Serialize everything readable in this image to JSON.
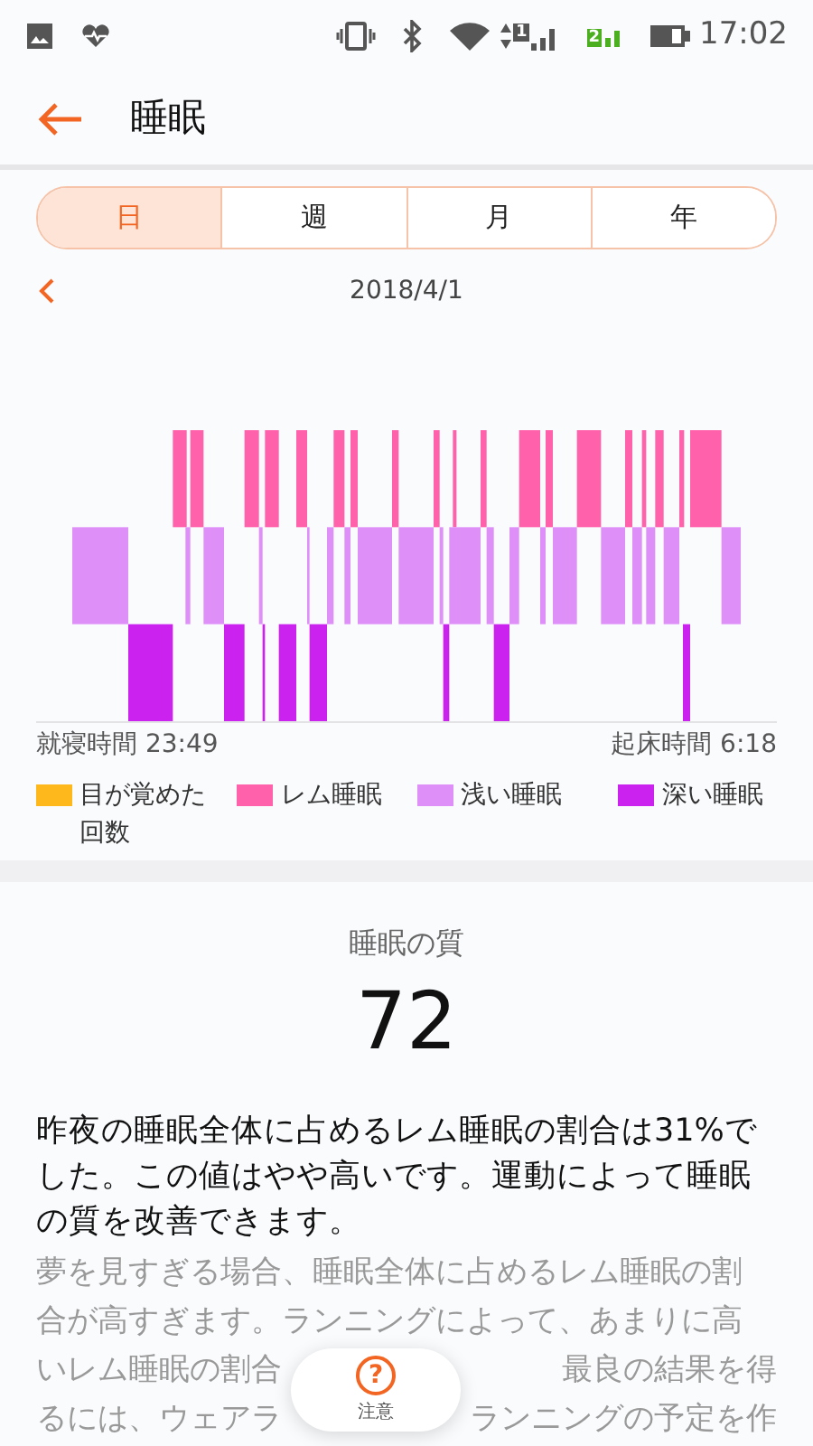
{
  "status_bar": {
    "sim_1": "1",
    "sim_2": "2",
    "time": "17:02"
  },
  "header": {
    "title": "睡眠"
  },
  "tabs": [
    {
      "label": "日",
      "selected": true
    },
    {
      "label": "週",
      "selected": false
    },
    {
      "label": "月",
      "selected": false
    },
    {
      "label": "年",
      "selected": false
    }
  ],
  "date_nav": {
    "date": "2018/4/1"
  },
  "chart": {
    "bedtime": "就寝時間 23:49",
    "wake_time": "起床時間 6:18"
  },
  "legend": [
    {
      "label": "目が覚めた回数",
      "color": "#ffb81c"
    },
    {
      "label": "レム睡眠",
      "color": "#ff62aa"
    },
    {
      "label": "浅い睡眠",
      "color": "#df8ff8"
    },
    {
      "label": "深い睡眠",
      "color": "#cc22f0"
    }
  ],
  "quality": {
    "title": "睡眠の質",
    "score": "72"
  },
  "summary": "昨夜の睡眠全体に占めるレム睡眠の割合は31%でした。この値はやや高いです。運動によって睡眠の質を改善できます。",
  "detail_lines": [
    {
      "left": "夢を見すぎる場合、睡眠全体に占めるレム睡眠の割"
    },
    {
      "left": "合が高すぎます。ランニングによって、あまりに高"
    },
    {
      "left": "いレム睡眠の割合",
      "right": "最良の結果を得"
    },
    {
      "left": "るには、ウェアラ",
      "right": "ランニングの予定を作"
    }
  ],
  "notice_button": {
    "icon": "?",
    "label": "注意"
  }
}
